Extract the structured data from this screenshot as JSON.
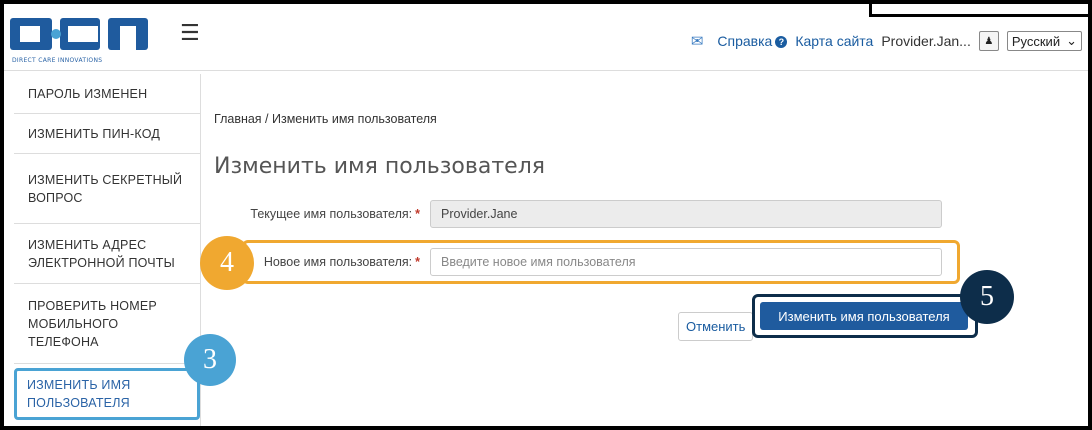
{
  "header": {
    "logo_text": "DCI",
    "logo_sub": "DIRECT CARE INNOVATIONS",
    "help": "Справка",
    "sitemap": "Карта сайта",
    "user": "Provider.Jan...",
    "language": "Русский",
    "icons": [
      "mail-icon",
      "help-icon",
      "user-icon",
      "chevron-down-icon",
      "hamburger-icon"
    ]
  },
  "sidebar": {
    "items": [
      {
        "label": "ПАРОЛЬ ИЗМЕНЕН"
      },
      {
        "label": "ИЗМЕНИТЬ ПИН-КОД"
      },
      {
        "label": "ИЗМЕНИТЬ СЕКРЕТНЫЙ ВОПРОС"
      },
      {
        "label": "ИЗМЕНИТЬ АДРЕС ЭЛЕКТРОННОЙ ПОЧТЫ"
      },
      {
        "label": "ПРОВЕРИТЬ НОМЕР МОБИЛЬНОГО ТЕЛЕФОНА"
      },
      {
        "label": "ИЗМЕНИТЬ ИМЯ ПОЛЬЗОВАТЕЛЯ"
      }
    ],
    "active_index": 5
  },
  "main": {
    "breadcrumb": "Главная / Изменить имя пользователя",
    "title": "Изменить имя пользователя",
    "current_label": "Текущее имя пользователя:",
    "current_value": "Provider.Jane",
    "new_label": "Новое имя пользователя:",
    "new_placeholder": "Введите новое имя пользователя",
    "required_mark": "*",
    "cancel": "Отменить",
    "submit": "Изменить имя пользователя"
  },
  "markers": {
    "m3": "3",
    "m4": "4",
    "m5": "5"
  },
  "colors": {
    "accent": "#1f5b9e",
    "marker3": "#4aa3d4",
    "marker4": "#f0a830",
    "marker5": "#0d2d4a"
  }
}
